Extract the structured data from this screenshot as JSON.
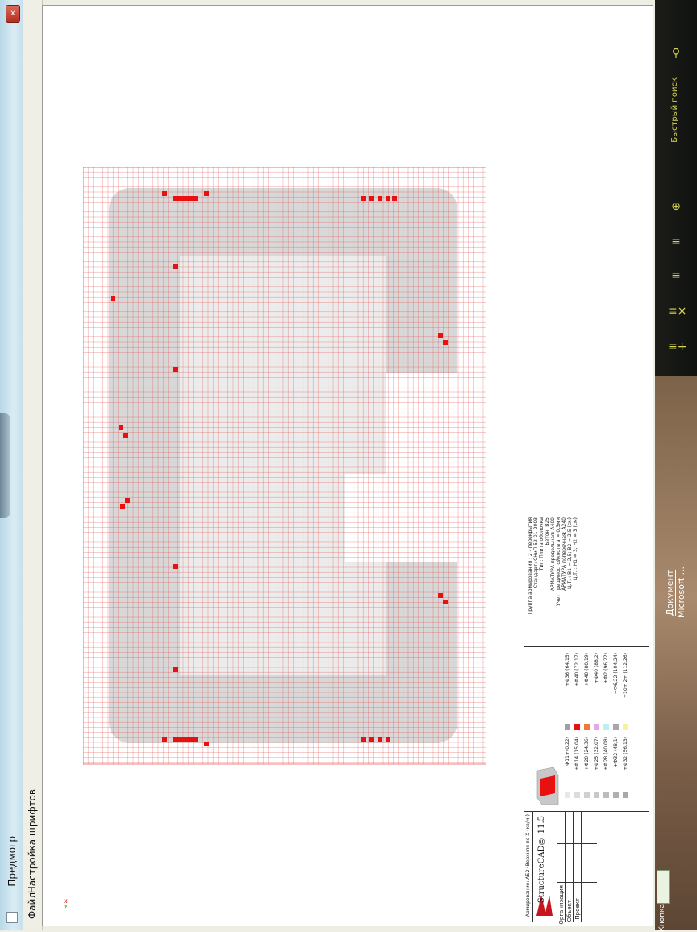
{
  "window": {
    "title": "Предмогр",
    "close_label": "x",
    "menu": [
      "Файл",
      "Настройка шрифтов"
    ]
  },
  "sidebar": {
    "search_label": "Быстрый поиск",
    "tools": [
      "search-icon",
      "zoom-in-icon",
      "list-icon",
      "list-icon",
      "list-remove-icon",
      "list-add-icon"
    ]
  },
  "desktop": {
    "doc_label_1": "Документ",
    "doc_label_2": "Microsoft ...",
    "taskbar_label": "Кнопка"
  },
  "drawing": {
    "header": "Армирование: АБ2 (Верхняя по Х (кв/м))",
    "app_name": "StructureCAD® 11.5",
    "fields": [
      "Организация",
      "Объект",
      "Проект"
    ],
    "legend_left": [
      "Ф11+(0,22)",
      "+Ф14 (15,04)",
      "+Ф20 (24,36)",
      "+Ф25 (32,07)",
      "+Ф28 (40,08)",
      "+Ф32 (48,1)",
      "+Ф32 (56,13)"
    ],
    "legend_right": [
      "+Ф36 (64,15)",
      "+Ф40 (72,17)",
      "+Ф40 (80,19)",
      "+Ф40 (88,2)",
      "+Ф2 (96,22)",
      "+Ф6,22 (104,24)",
      "+10+,2+ (112,26)"
    ],
    "legend_colors": [
      "#e8e8e8",
      "#dcdcdc",
      "#d0d0d0",
      "#c8c8c8",
      "#bcbcbc",
      "#b0b0b0",
      "#a8a8a8",
      "#a0a0a0",
      "#e81010",
      "#f07838",
      "#e4a8e4",
      "#b8f0f4",
      "#a8a8a8",
      "#f4f4a0"
    ],
    "notes": [
      "Группа армирования : 2 - перекрытия",
      "Стандарт: СНиП 52-01-2003",
      "Тип: Плита оболочка",
      "Бетон: B25",
      "АРМАТУРА продольная: A400",
      "Учет трещиностойкости a = 0,3мм",
      "АРМАТУРА поперечная: A240",
      "Ц.Т. : В1 =   2,5; В2 =   2,5 (см)",
      "Ц.Т. : Н1 =   3; Н2 =   3 (см)"
    ]
  }
}
